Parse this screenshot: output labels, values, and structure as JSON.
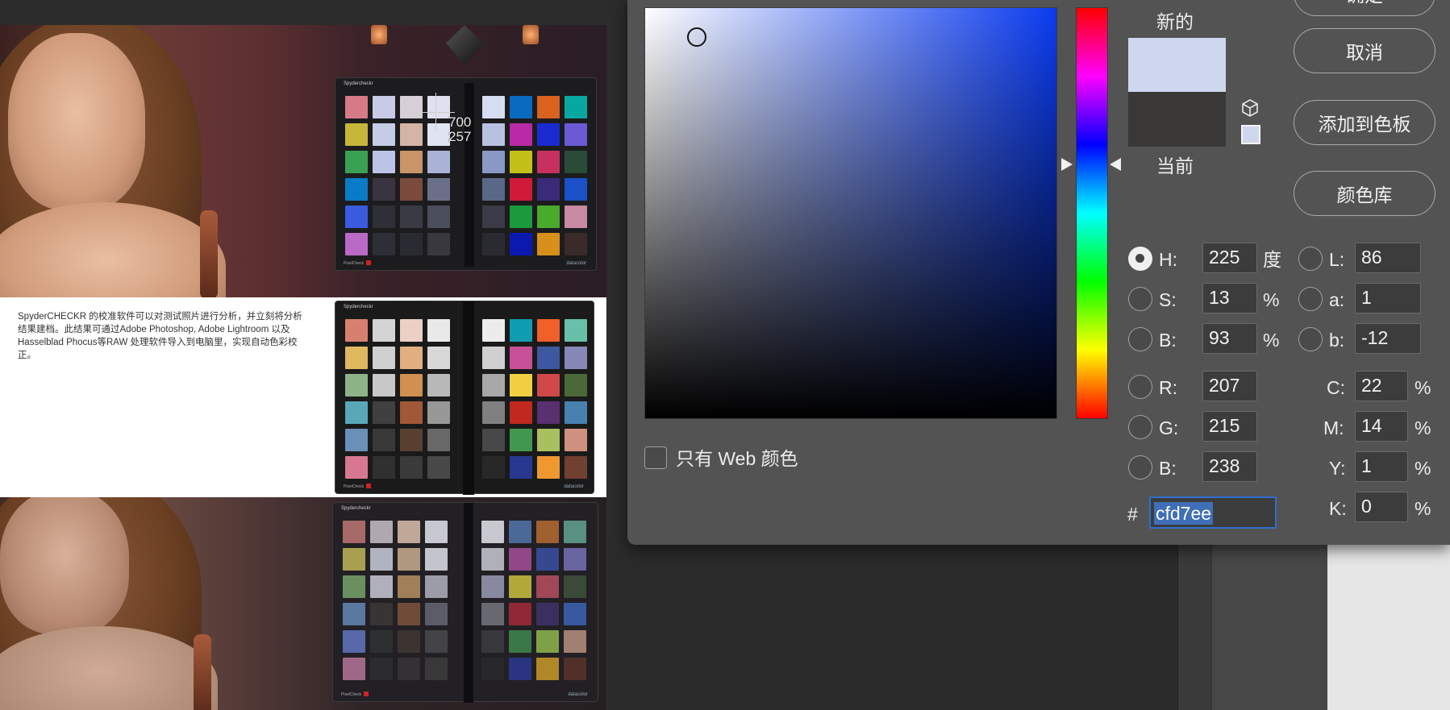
{
  "picker": {
    "new_label": "新的",
    "current_label": "当前",
    "new_color": "#cfd7ee",
    "current_color": "#3a3836",
    "buttons": {
      "ok": "确定",
      "cancel": "取消",
      "add_to_swatches": "添加到色板",
      "color_libraries": "颜色库"
    },
    "web_only_label": "只有 Web 颜色",
    "hsb": {
      "h_label": "H:",
      "h_value": "225",
      "h_unit": "度",
      "s_label": "S:",
      "s_value": "13",
      "s_unit": "%",
      "b_label": "B:",
      "b_value": "93",
      "b_unit": "%"
    },
    "rgb": {
      "r_label": "R:",
      "r_value": "207",
      "g_label": "G:",
      "g_value": "215",
      "b_label": "B:",
      "b_value": "238"
    },
    "lab": {
      "l_label": "L:",
      "l_value": "86",
      "a_label": "a:",
      "a_value": "1",
      "b_label": "b:",
      "b_value": "-12"
    },
    "cmyk": {
      "c_label": "C:",
      "c_value": "22",
      "m_label": "M:",
      "m_value": "14",
      "y_label": "Y:",
      "y_value": "1",
      "k_label": "K:",
      "k_value": "0",
      "unit": "%"
    },
    "hex_prefix": "#",
    "hex_value": "cfd7ee",
    "selected_mode": "H"
  },
  "canvas": {
    "coord_x": "700",
    "coord_y": "257",
    "article_text": "SpyderCHECKR 的校准软件可以对测试照片进行分析，并立刻将分析结果建档。此结果可通过Adobe Photoshop, Adobe Lightroom 以及 Hasselblad Phocus等RAW 处理软件导入到电脑里，实现自动色彩校正。",
    "checker_brand": "Spydercheckr",
    "checker_maker": "datacolor",
    "checker_pen": "PixelCheck"
  },
  "checker_colors": {
    "top_left": [
      "#d77a88",
      "#c9cbe6",
      "#d6cfd8",
      "#e0e0ef",
      "#c6b63a",
      "#c4cce6",
      "#d3b4a6",
      "#e0e3f2",
      "#3aa054",
      "#bcc4e6",
      "#c89468",
      "#aab3d6",
      "#0a7bc8",
      "#3a3440",
      "#7a4a3c",
      "#6a7088",
      "#3a5ae0",
      "#2f2f38",
      "#3a3a44",
      "#4a4e5c",
      "#b86ac6",
      "#2e2e36",
      "#2a2a32",
      "#38383e"
    ],
    "top_right": [
      "#d6dcf2",
      "#0a6ac0",
      "#d8621e",
      "#08a8a0",
      "#b8c2e0",
      "#b82aa8",
      "#1a2ad0",
      "#6a5ad6",
      "#8a98c6",
      "#c4c01a",
      "#c83060",
      "#2a4a3a",
      "#5a6888",
      "#d01a3a",
      "#3a2a7a",
      "#1a50c8",
      "#3a3a48",
      "#1a9a3a",
      "#4aaa2a",
      "#c88aa0",
      "#2a2a32",
      "#0a1ab0",
      "#d8901a",
      "#3a2a2a"
    ],
    "mid_left": [
      "#d88070",
      "#d4d4d4",
      "#ecd0c4",
      "#e8e8e8",
      "#e0b860",
      "#d0d0d0",
      "#e0b080",
      "#d8d8d8",
      "#8cb488",
      "#c8c8c8",
      "#d09050",
      "#b8b8b8",
      "#58a8b8",
      "#404040",
      "#a05838",
      "#989898",
      "#6a90b8",
      "#383838",
      "#584030",
      "#686868",
      "#d87890",
      "#303030",
      "#3a3a3a",
      "#484848"
    ],
    "mid_right": [
      "#ececec",
      "#109cb0",
      "#f06028",
      "#68c0a8",
      "#d0d0d0",
      "#c85098",
      "#3c58a0",
      "#8888b8",
      "#a8a8a8",
      "#f0d040",
      "#d04848",
      "#4a6838",
      "#808080",
      "#c02820",
      "#5a3070",
      "#4880b0",
      "#484848",
      "#409850",
      "#a8c060",
      "#d09080",
      "#282828",
      "#283890",
      "#f09830",
      "#704030"
    ],
    "bot_left": [
      "#a86a68",
      "#b0a8b0",
      "#c0a898",
      "#c8c8d0",
      "#a8a050",
      "#b0b4c0",
      "#b09880",
      "#c4c4cc",
      "#6a9060",
      "#b0b0bc",
      "#a08058",
      "#9c9ca8",
      "#5a78a0",
      "#383434",
      "#704c38",
      "#5c5c68",
      "#5868a8",
      "#2c3030",
      "#3c3430",
      "#444448",
      "#a06888",
      "#2c2c30",
      "#343034",
      "#383838"
    ],
    "bot_right": [
      "#c8c8d0",
      "#4a6898",
      "#a06030",
      "#5a9080",
      "#b0b0b8",
      "#904888",
      "#384890",
      "#6a64a0",
      "#8888a0",
      "#b0a838",
      "#a04858",
      "#3a4a38",
      "#686870",
      "#902838",
      "#3a3060",
      "#3858a0",
      "#38383c",
      "#3a7848",
      "#80a048",
      "#a08070",
      "#28282c",
      "#2a3480",
      "#b08828",
      "#503028"
    ]
  }
}
